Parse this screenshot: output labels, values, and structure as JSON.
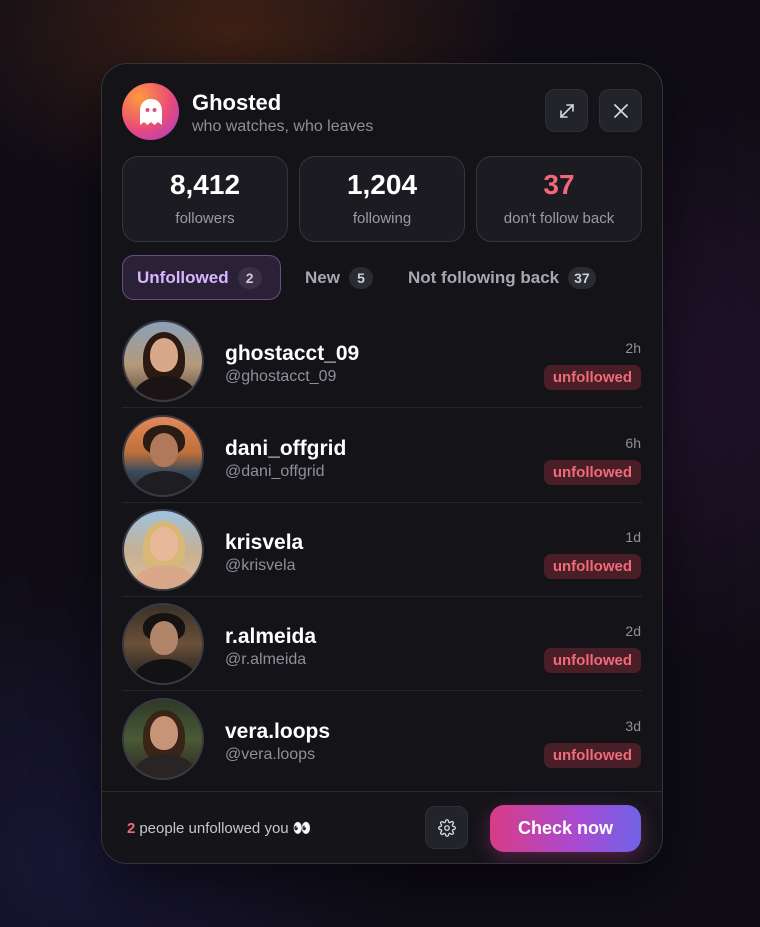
{
  "header": {
    "title": "Ghosted",
    "subtitle": "who watches, who leaves",
    "logo_icon": "ghost-icon",
    "expand_icon": "expand-icon",
    "close_icon": "close-icon"
  },
  "stats": [
    {
      "value": "8,412",
      "label": "followers"
    },
    {
      "value": "1,204",
      "label": "following"
    },
    {
      "value": "37",
      "label": "don't follow back",
      "color": "#f0687a"
    }
  ],
  "tabs": [
    {
      "label": "Unfollowed",
      "count": "2",
      "active": true
    },
    {
      "label": "New",
      "count": "5",
      "active": false
    },
    {
      "label": "Not following back",
      "count": "37",
      "active": false
    }
  ],
  "list": [
    {
      "name": "ghostacct_09",
      "handle": "@ghostacct_09",
      "time": "2h",
      "status": "unfollowed"
    },
    {
      "name": "dani_offgrid",
      "handle": "@dani_offgrid",
      "time": "6h",
      "status": "unfollowed"
    },
    {
      "name": "krisvela",
      "handle": "@krisvela",
      "time": "1d",
      "status": "unfollowed"
    },
    {
      "name": "r.almeida",
      "handle": "@r.almeida",
      "time": "2d",
      "status": "unfollowed"
    },
    {
      "name": "vera.loops",
      "handle": "@vera.loops",
      "time": "3d",
      "status": "unfollowed"
    }
  ],
  "footer": {
    "count": "2",
    "text": "people unfollowed you 👀",
    "settings_icon": "gear-icon",
    "button_label": "Check now"
  },
  "colors": {
    "accent_red": "#f06b79",
    "tab_active_text": "#d8b5ff",
    "button_gradient_start": "#d83c86",
    "button_gradient_end": "#6f63e6"
  }
}
